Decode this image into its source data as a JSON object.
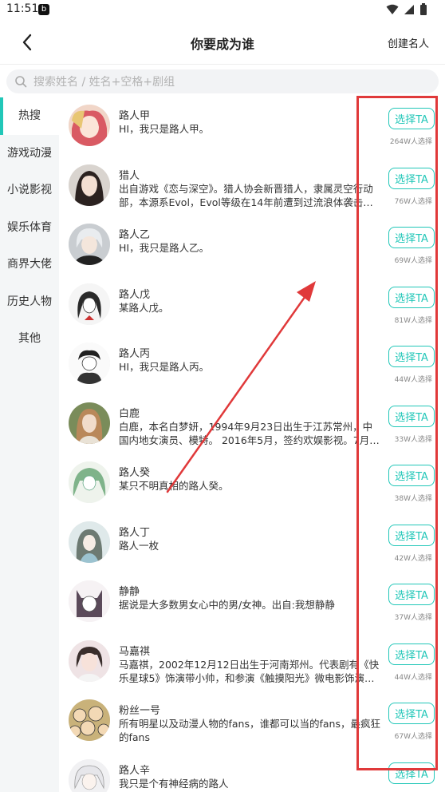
{
  "status": {
    "time": "11:51",
    "app_badge": "b"
  },
  "header": {
    "title": "你要成为谁",
    "create_label": "创建名人"
  },
  "search": {
    "placeholder": "搜索姓名 / 姓名+空格+剧组"
  },
  "sidebar": {
    "items": [
      {
        "label": "热搜",
        "active": true
      },
      {
        "label": "游戏动漫"
      },
      {
        "label": "小说影视"
      },
      {
        "label": "娱乐体育"
      },
      {
        "label": "商界大佬"
      },
      {
        "label": "历史人物"
      },
      {
        "label": "其他"
      }
    ]
  },
  "list": {
    "rows": [
      {
        "name": "路人甲",
        "desc": "HI，我只是路人甲。",
        "button": "选择TA",
        "count": "264W人选择",
        "avatar": "anime-couple"
      },
      {
        "name": "猎人",
        "desc": "出自游戏《恋与深空》。猎人协会新晋猎人，隶属灵空行动部，本源系Evol，Evol等级在14年前遭到过流浪体袭击…",
        "button": "选择TA",
        "count": "76W人选择",
        "avatar": "girl-portrait"
      },
      {
        "name": "路人乙",
        "desc": "HI，我只是路人乙。",
        "button": "选择TA",
        "count": "69W人选择",
        "avatar": "anime-boy-white-hair"
      },
      {
        "name": "路人戊",
        "desc": "某路人戊。",
        "button": "选择TA",
        "count": "81W人选择",
        "avatar": "anime-girl-sketch"
      },
      {
        "name": "路人丙",
        "desc": "HI，我只是路人丙。",
        "button": "选择TA",
        "count": "44W人选择",
        "avatar": "sketch-figure"
      },
      {
        "name": "白鹿",
        "desc": "白鹿，本名白梦妍，1994年9月23日出生于江苏常州，中国内地女演员、模特。 2016年5月，签约欢娱影视。7月…",
        "button": "选择TA",
        "count": "33W人选择",
        "avatar": "actress-photo"
      },
      {
        "name": "路人癸",
        "desc": "某只不明真相的路人癸。",
        "button": "选择TA",
        "count": "38W人选择",
        "avatar": "anime-green-hair"
      },
      {
        "name": "路人丁",
        "desc": "路人一枚",
        "button": "选择TA",
        "count": "42W人选择",
        "avatar": "anime-girl-blue"
      },
      {
        "name": "静静",
        "desc": "据说是大多数男女心中的男/女神。出自:我想静静",
        "button": "选择TA",
        "count": "37W人选择",
        "avatar": "anime-cat-girl"
      },
      {
        "name": "马嘉祺",
        "desc": "马嘉祺，2002年12月12日出生于河南郑州。代表剧有《快乐星球5》饰演带小帅，和参演《触摸阳光》微电影饰演…",
        "button": "选择TA",
        "count": "44W人选择",
        "avatar": "young-man-photo"
      },
      {
        "name": "粉丝一号",
        "desc": "所有明星以及动漫人物的fans，谁都可以当的fans，最疯狂的fans",
        "button": "选择TA",
        "count": "67W人选择",
        "avatar": "cartoon-crowd"
      },
      {
        "name": "路人辛",
        "desc": "我只是个有神经病的路人",
        "button": "选择TA",
        "count": "",
        "avatar": "anime-white-hair"
      }
    ]
  },
  "colors": {
    "accent": "#22c7b8",
    "annotation_red": "#e0393a",
    "sidebar_bg": "#f4f6f7"
  }
}
